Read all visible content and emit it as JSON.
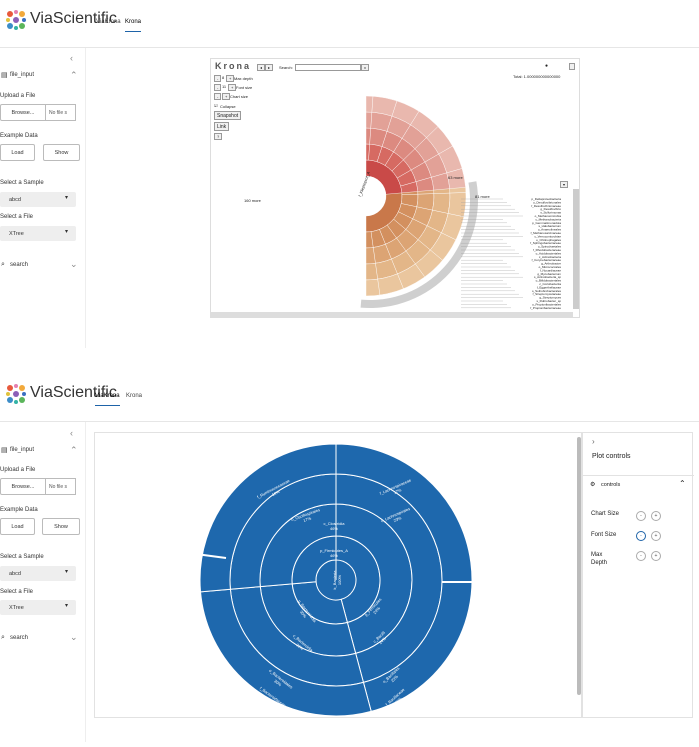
{
  "brand": "ViaScientific",
  "tabs": {
    "viakrona": "ViaKrona",
    "krona": "Krona"
  },
  "sidebar": {
    "collapse": "‹",
    "section": "file_input",
    "upload_label": "Upload a File",
    "browse": "Browse...",
    "no_file": "No file s",
    "example_label": "Example Data",
    "load": "Load",
    "show": "Show",
    "sample_label": "Select a Sample",
    "sample_value": "abcd",
    "file_label": "Select a File",
    "file_value": "XTree",
    "search": "search"
  },
  "krona": {
    "logo": "Krona",
    "search_label": "Search:",
    "max_depth": "Max depth",
    "font_size": "Font size",
    "chart_size": "Chart size",
    "collapse": "Collapse",
    "snapshot": "Snapshot",
    "link": "Link",
    "help": "?",
    "total": "Total: 1.000000000000000",
    "depth_value": "8",
    "font_value": "11",
    "root_label": "f_Kleptoprot_A",
    "left_label": "160 more",
    "right_label": "81 more",
    "top_label": "63 more",
    "list": [
      "p_Deltaproteobacteria",
      "o_Desulfovibrionales",
      "f_Desulfovibrionaceae",
      "g_Desulfovibrio",
      "s_Sulfurimonas",
      "o_Methanomicrobia",
      "c_Methanobacteria",
      "p_Gemmatimonadota",
      "s_Halobacterium",
      "o_Anaerolineales",
      "f_Methanosarcinaceae",
      "c_Verrucomicrobiae",
      "o_Chitinophagales",
      "f_Sphingobacteriaceae",
      "o_Spirochaetales",
      "f_Rhodobacteraceae",
      "o_Acidobacteriales",
      "c_Actinobacteria",
      "f_Corynebacteriaceae",
      "g_Arthrobacter",
      "o_Micrococcales",
      "f_Nocardiaceae",
      "g_Mycobacterium",
      "s_Actinobacteria_sp",
      "o_Bifidobacteriales",
      "c_Coriobacteriia",
      "f_Eggerthellaceae",
      "o_Solirubrobacterales",
      "f_Streptomycetaceae",
      "g_Streptomyces",
      "s_Rubrobacter_sp",
      "o_Propionibacteriales",
      "f_Propionibacteriaceae"
    ]
  },
  "viakrona": {
    "labels": [
      {
        "n": "f_Ruminococcaceae",
        "v": "18%"
      },
      {
        "n": "f_Lachnospiraceae",
        "v": "17%"
      },
      {
        "n": "o_Oscillospirales",
        "v": "17%"
      },
      {
        "n": "o_Lachnospirales",
        "v": "23%"
      },
      {
        "n": "c_Clostridia",
        "v": "46%"
      },
      {
        "n": "p_Firmicutes_A",
        "v": "46%"
      },
      {
        "n": "k_Bacteria",
        "v": "100%"
      },
      {
        "n": "p_Bacteroidota",
        "v": "30%"
      },
      {
        "n": "p_Firmicutes",
        "v": "24%"
      },
      {
        "n": "c_Bacteroidia",
        "v": "30%"
      },
      {
        "n": "c_Bacilli",
        "v": "24%"
      },
      {
        "n": "o_Bacteroidales",
        "v": "30%"
      },
      {
        "n": "o_Bacillales",
        "v": "23%"
      },
      {
        "n": "f_Bacteroidaceae",
        "v": "30%"
      },
      {
        "n": "f_Bacillaceae",
        "v": "23%"
      }
    ]
  },
  "plot_controls": {
    "title": "Plot controls",
    "section": "controls",
    "chart_size": "Chart Size",
    "font_size": "Font Size",
    "max_depth_1": "Max",
    "max_depth_2": "Depth",
    "minus": "-",
    "plus": "+"
  },
  "colors": {
    "sunburst": "#1e68ad",
    "krona_pink": "#d9857c",
    "krona_orange": "#d8a276",
    "accent": "#1e63a8"
  }
}
